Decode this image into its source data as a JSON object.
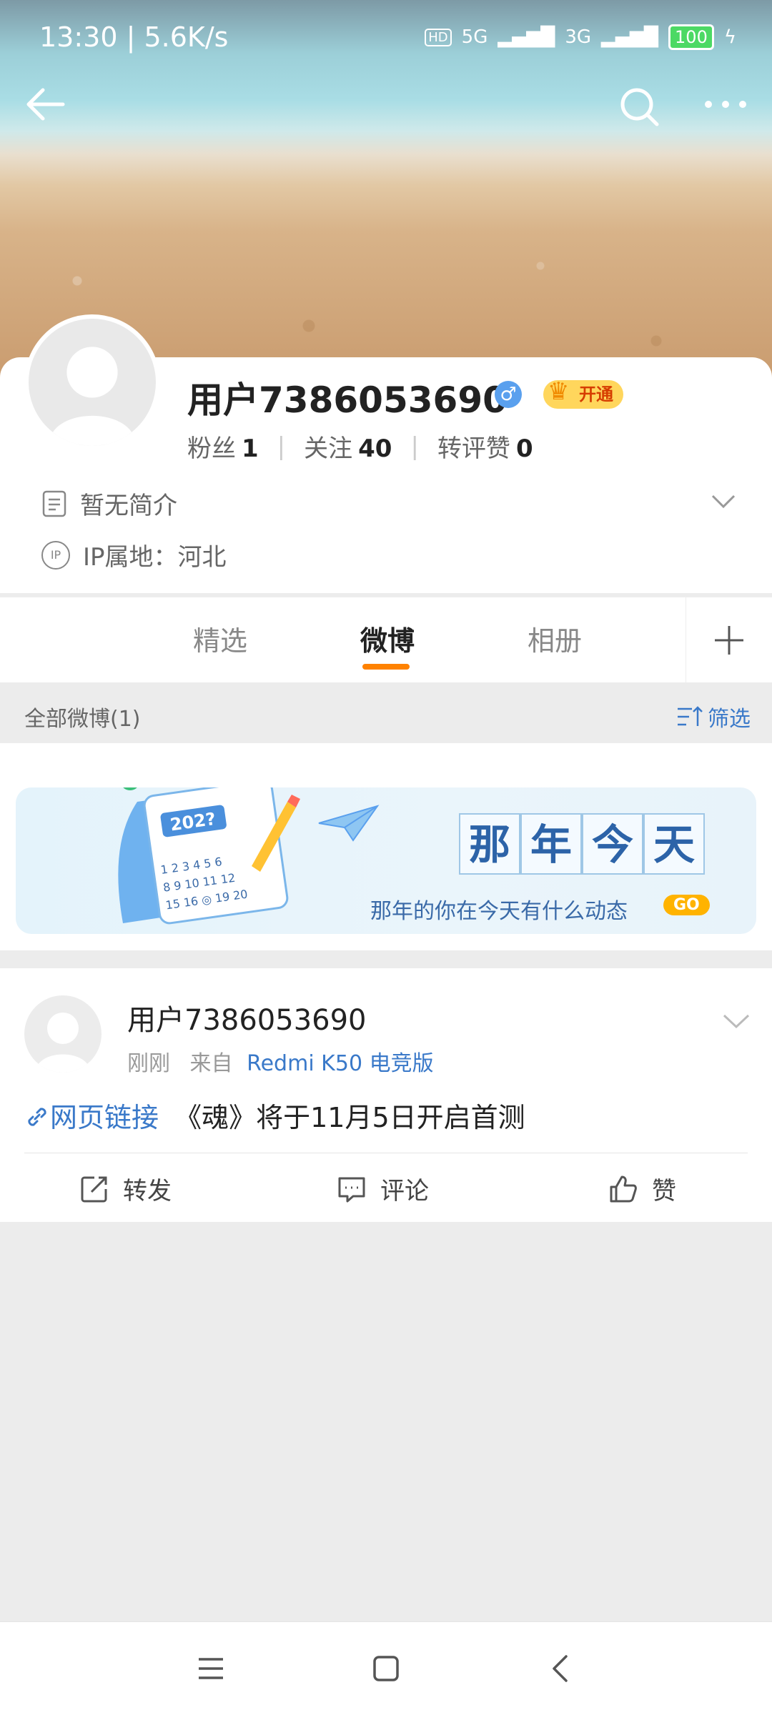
{
  "statusbar": {
    "time": "13:30 | 5.6K/s",
    "hd": "HD",
    "net1": "5G",
    "net2": "3G",
    "battery": "100"
  },
  "profile": {
    "username": "用户7386053690",
    "vip_label": "开通",
    "fans_label": "粉丝",
    "fans_count": "1",
    "follow_label": "关注",
    "follow_count": "40",
    "likes_label": "转评赞",
    "likes_count": "0",
    "bio": "暂无简介",
    "ip_badge": "IP",
    "ip_location": "IP属地：河北"
  },
  "tabs": [
    {
      "label": "精选",
      "active": false
    },
    {
      "label": "微博",
      "active": true
    },
    {
      "label": "相册",
      "active": false
    }
  ],
  "feed": {
    "header": "全部微博(1)",
    "filter": "筛选"
  },
  "on_this_day": {
    "title_chars": [
      "那",
      "年",
      "今",
      "天"
    ],
    "subtitle": "那年的你在今天有什么动态",
    "go": "GO",
    "calendar_year": "202?"
  },
  "post": {
    "author": "用户7386053690",
    "time": "刚刚",
    "from_label": "来自",
    "source": "Redmi K50 电竞版",
    "link_label": "网页链接",
    "text": "《魂》将于11月5日开启首测",
    "actions": {
      "repost": "转发",
      "comment": "评论",
      "like": "赞"
    }
  },
  "colors": {
    "accent": "#ff8200",
    "link": "#3a79c9"
  }
}
